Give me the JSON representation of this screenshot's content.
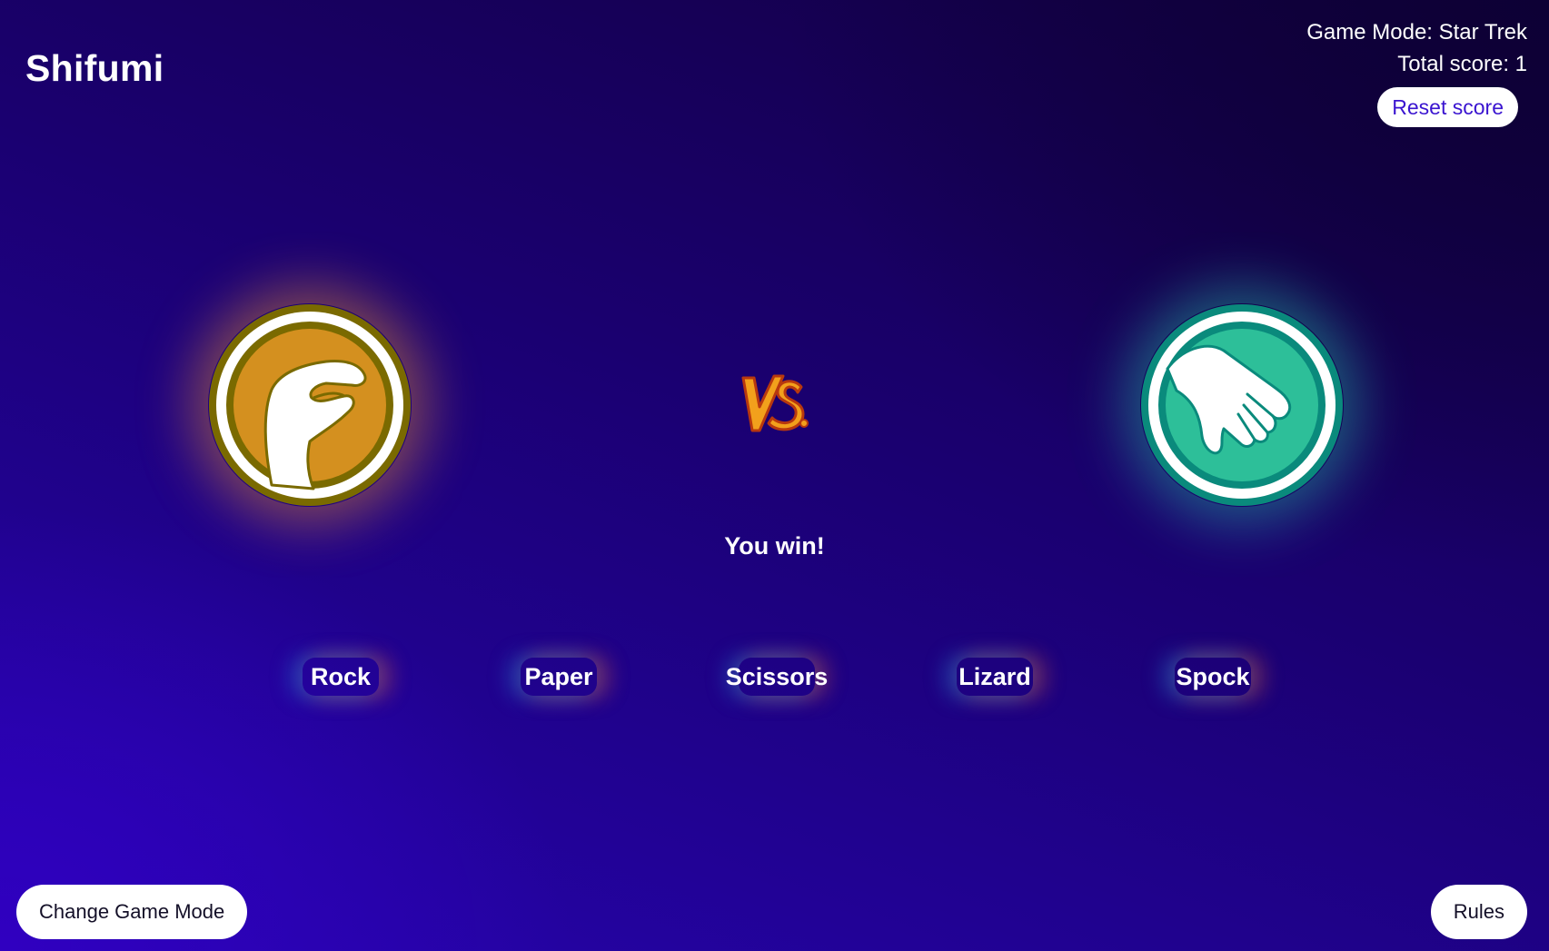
{
  "header": {
    "title": "Shifumi",
    "game_mode": "Game Mode: Star Trek",
    "total_score": "Total score: 1",
    "reset_label": "Reset score"
  },
  "board": {
    "player_pick": {
      "icon": "hand-pinch-icon",
      "ring_color": "#7a6a00",
      "fill_color": "#d4901f"
    },
    "cpu_pick": {
      "icon": "hand-paper-icon",
      "ring_color": "#0a8a7c",
      "fill_color": "#2dbf99"
    },
    "vs_icon": "vs-icon",
    "result": "You win!"
  },
  "choices": [
    {
      "label": "Rock"
    },
    {
      "label": "Paper"
    },
    {
      "label": "Scissors"
    },
    {
      "label": "Lizard"
    },
    {
      "label": "Spock"
    }
  ],
  "footer": {
    "change_mode_label": "Change Game Mode",
    "rules_label": "Rules"
  }
}
